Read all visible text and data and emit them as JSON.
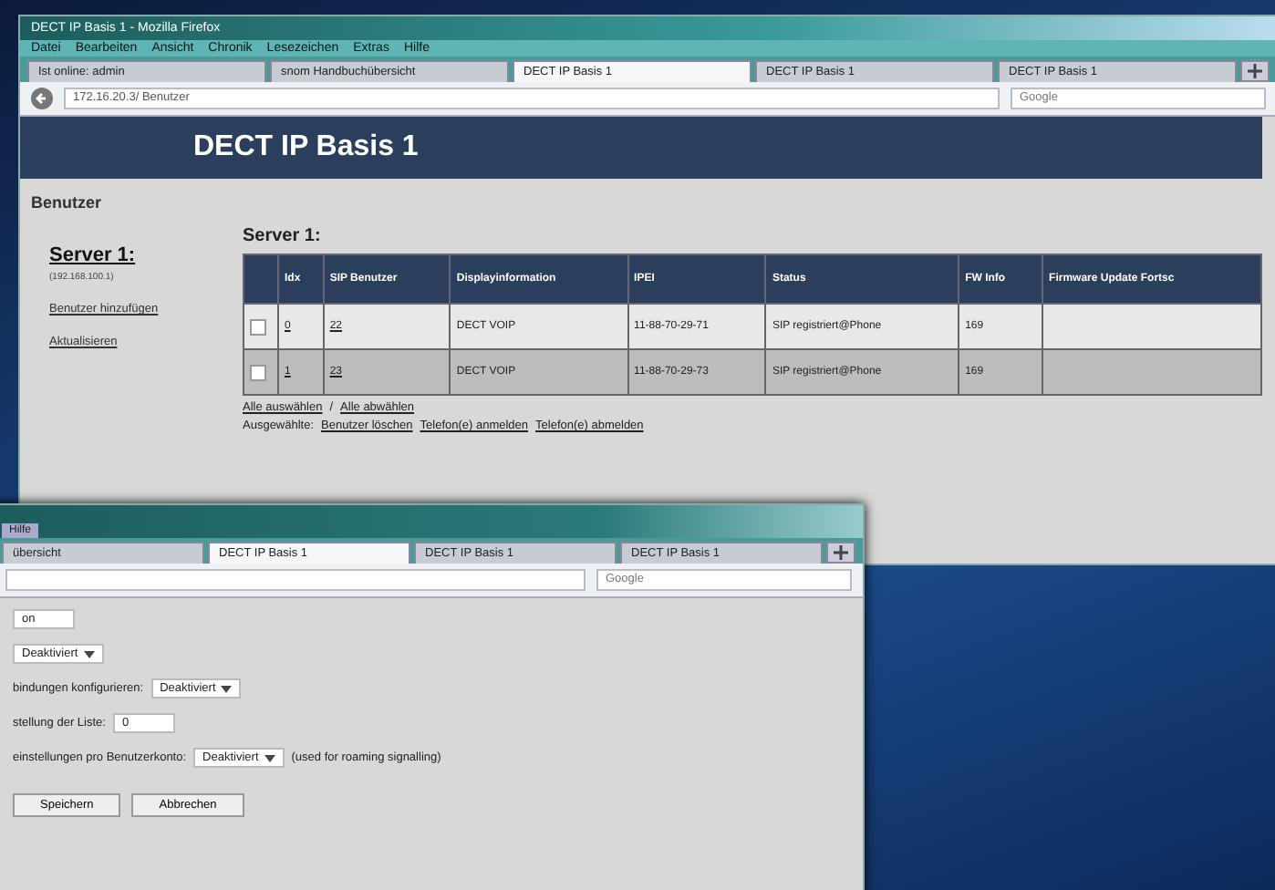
{
  "back_window": {
    "title": "DECT IP Basis 1 - Mozilla Firefox",
    "menu": [
      "Datei",
      "Bearbeiten",
      "Ansicht",
      "Chronik",
      "Lesezeichen",
      "Extras",
      "Hilfe"
    ],
    "tabs": [
      {
        "label": "Ist online: admin",
        "selected": false
      },
      {
        "label": "snom Handbuchübersicht",
        "selected": false
      },
      {
        "label": "DECT IP Basis 1",
        "selected": true
      },
      {
        "label": "DECT IP Basis 1",
        "selected": false
      },
      {
        "label": "DECT IP Basis 1",
        "selected": false
      }
    ],
    "url": "172.16.20.3/ Benutzer",
    "search": {
      "placeholder": "Google"
    },
    "header": "DECT IP Basis 1",
    "section": "Benutzer",
    "sidebar": {
      "server": "Server 1:",
      "server_sub": "(192.168.100.1)",
      "links": [
        "Benutzer hinzufügen",
        "Aktualisieren"
      ]
    },
    "table": {
      "title": "Server 1:",
      "columns": [
        "Idx",
        "SIP Benutzer",
        "Displayinformation",
        "IPEI",
        "Status",
        "FW Info",
        "Firmware Update Fortsc"
      ],
      "rows": [
        {
          "highlighted": false,
          "cells": [
            "0",
            "22",
            "DECT VOIP",
            "11-88-70-29-71",
            "SIP registriert@Phone",
            "169"
          ]
        },
        {
          "highlighted": true,
          "cells": [
            "1",
            "23",
            "DECT VOIP",
            "11-88-70-29-73",
            "SIP registriert@Phone",
            "169"
          ]
        }
      ]
    },
    "select_links": [
      "Alle auswählen",
      "Alle abwählen"
    ],
    "select_separator": "/",
    "actions_label": "Ausgewählte:",
    "actions": [
      "Benutzer löschen",
      "Telefon(e) anmelden",
      "Telefon(e) abmelden"
    ]
  },
  "front_window": {
    "menu_fragment": "Hilfe",
    "tabs": [
      {
        "label": "übersicht",
        "selected": false
      },
      {
        "label": "DECT IP Basis 1",
        "selected": true
      },
      {
        "label": "DECT IP Basis 1",
        "selected": false
      },
      {
        "label": "DECT IP Basis 1",
        "selected": false
      }
    ],
    "search": {
      "placeholder": "Google"
    },
    "form": [
      {
        "kind": "field",
        "value": "on"
      },
      {
        "kind": "select",
        "value": "Deaktiviert"
      },
      {
        "kind": "select",
        "label": "bindungen konfigurieren:",
        "value": "Deaktiviert"
      },
      {
        "kind": "field",
        "label": "stellung der Liste:",
        "value": "0"
      },
      {
        "kind": "select",
        "label": "einstellungen pro Benutzerkonto:",
        "value": "Deaktiviert",
        "note": "(used for roaming signalling)"
      }
    ],
    "buttons": [
      "Speichern",
      "Abbrechen"
    ]
  }
}
